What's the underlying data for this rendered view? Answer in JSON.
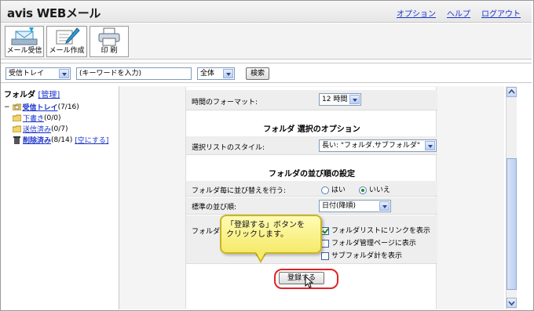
{
  "app": {
    "brand": "avis WEBメール",
    "top_links": [
      "オプション",
      "ヘルプ",
      "ログアウト"
    ]
  },
  "toolbar": {
    "buttons": [
      {
        "label": "メール受信",
        "icon": "mail-receive-icon"
      },
      {
        "label": "メール作成",
        "icon": "mail-compose-icon"
      },
      {
        "label": "印 刷",
        "icon": "printer-icon"
      }
    ]
  },
  "search": {
    "folder_select": "受信トレイ",
    "keyword_value": "(キーワードを入力)",
    "scope_select": "全体",
    "search_button": "検索"
  },
  "sidebar": {
    "title": "フォルダ",
    "manage_link": "[管理]",
    "folders": [
      {
        "name": "受信トレイ",
        "count": "(7/16)",
        "icon": "inbox-folder-icon"
      },
      {
        "name": "下書き",
        "count": "(0/0)",
        "icon": "drafts-folder-icon"
      },
      {
        "name": "送信済み",
        "count": "(0/7)",
        "icon": "sent-folder-icon"
      },
      {
        "name": "削除済み",
        "count": "(8/14)",
        "icon": "trash-icon",
        "action": "[空にする]"
      }
    ],
    "collapse_symbol": "−"
  },
  "settings": {
    "time_format_label": "時間のフォーマット:",
    "time_format_value": "12 時間",
    "section_folder_options": "フォルダ 選択のオプション",
    "list_style_label": "選択リストのスタイル:",
    "list_style_value": "長い: \"フォルダ.サブフォルダ\"",
    "section_sort": "フォルダの並び順の設定",
    "sort_each_label": "フォルダ毎に並び替えを行う:",
    "sort_yes": "はい",
    "sort_no": "いいえ",
    "default_order_label": "標準の並び順:",
    "default_order_value": "日付(降順)",
    "folder_list_label": "フォルダ",
    "checkbox_link": "フォルダリストにリンクを表示",
    "checkbox_manage": "フォルダ管理ページに表示",
    "checkbox_subtotal": "サブフォルダ計を表示",
    "submit": "登録する"
  },
  "callout": {
    "line1": "「登録する」ボタンを",
    "line2": "クリックします。"
  },
  "colors": {
    "link": "#1a33cc",
    "highlight": "#e0232a",
    "callout": "#f6ea6a"
  }
}
